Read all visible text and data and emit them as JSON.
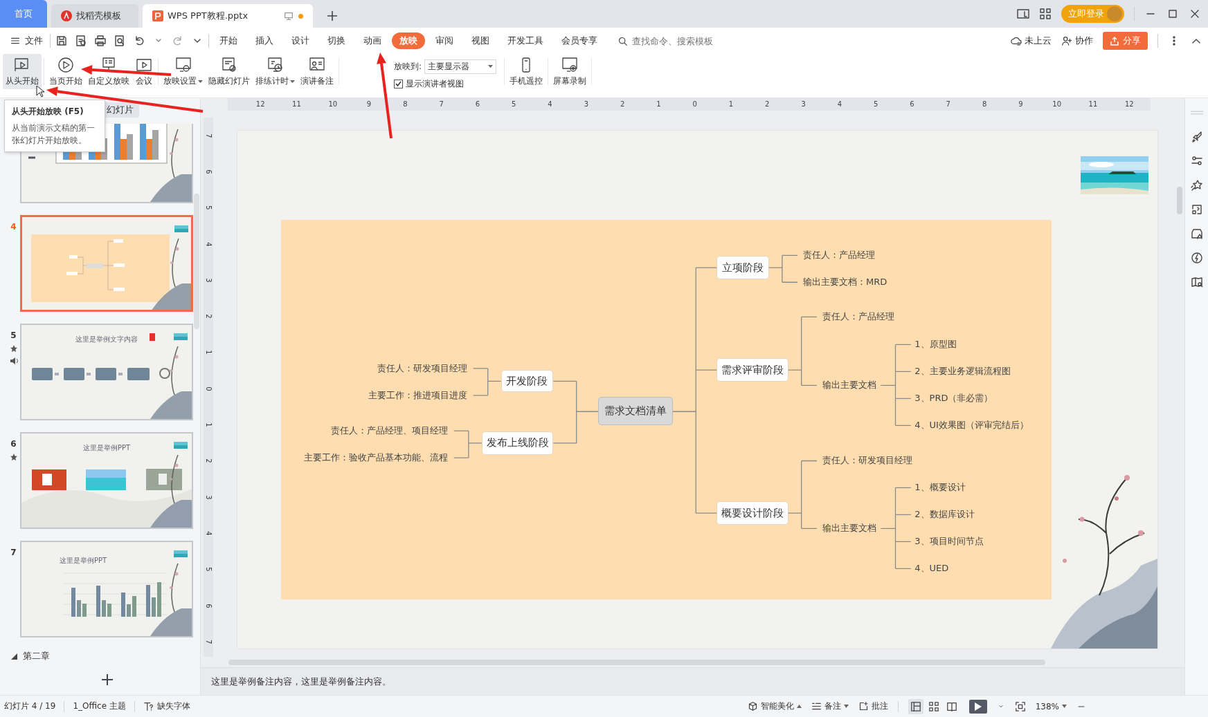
{
  "tabs": [
    {
      "label": "首页",
      "kind": "home",
      "selected": false
    },
    {
      "label": "找稻壳模板",
      "kind": "docer",
      "selected": false
    },
    {
      "label": "WPS PPT教程.pptx",
      "kind": "doc",
      "selected": true,
      "unsaved": true
    }
  ],
  "title_bar": {
    "login_button": "立即登录"
  },
  "menu": {
    "file": "文件",
    "tabs": [
      {
        "label": "开始",
        "selected": false
      },
      {
        "label": "插入",
        "selected": false
      },
      {
        "label": "设计",
        "selected": false
      },
      {
        "label": "切换",
        "selected": false
      },
      {
        "label": "动画",
        "selected": false
      },
      {
        "label": "放映",
        "selected": true
      },
      {
        "label": "审阅",
        "selected": false
      },
      {
        "label": "视图",
        "selected": false
      },
      {
        "label": "开发工具",
        "selected": false
      },
      {
        "label": "会员专享",
        "selected": false
      }
    ],
    "search": {
      "placeholder": "查找命令、搜索模板"
    },
    "cloud": "未上云",
    "collab": "协作",
    "share": "分享"
  },
  "ribbon": {
    "buttons": [
      {
        "label": "从头开始",
        "kind": "from-start",
        "hovered": true,
        "dropdown": false
      },
      {
        "label": "当页开始",
        "kind": "current",
        "hovered": false,
        "dropdown": false
      },
      {
        "label": "自定义放映",
        "kind": "custom",
        "hovered": false,
        "dropdown": false
      },
      {
        "label": "会议",
        "kind": "meeting",
        "hovered": false,
        "dropdown": false
      },
      {
        "label": "放映设置",
        "kind": "settings",
        "hovered": false,
        "dropdown": true
      },
      {
        "label": "隐藏幻灯片",
        "kind": "hide",
        "hovered": false,
        "dropdown": false
      },
      {
        "label": "排练计时",
        "kind": "timing",
        "hovered": false,
        "dropdown": true
      },
      {
        "label": "演讲备注",
        "kind": "notes",
        "hovered": false,
        "dropdown": false
      }
    ],
    "show_to": {
      "label": "放映到:",
      "value": "主要显示器"
    },
    "presenter_view": {
      "label": "显示演讲者视图",
      "checked": true
    },
    "buttons_right": [
      {
        "label": "手机遥控",
        "kind": "phone",
        "hovered": false,
        "dropdown": false
      },
      {
        "label": "屏幕录制",
        "kind": "record",
        "hovered": false,
        "dropdown": false
      }
    ]
  },
  "tooltip": {
    "title": "从头开始放映 (F5)",
    "text": "从当前演示文稿的第一张幻灯片开始放映。"
  },
  "slide_pane": {
    "tab": "幻灯片",
    "slides": [
      {
        "kind": "chart",
        "partial": true,
        "selected": false,
        "animation": false,
        "sound": false
      },
      {
        "number": "4",
        "kind": "mindmap",
        "selected": true,
        "animation": false,
        "sound": false
      },
      {
        "number": "5",
        "kind": "steps",
        "title": "这里是举例文字内容",
        "selected": false,
        "animation": true,
        "sound": true
      },
      {
        "number": "6",
        "kind": "images",
        "title": "这里是举例PPT",
        "selected": false,
        "animation": true,
        "sound": false
      },
      {
        "number": "7",
        "kind": "bars",
        "title": "这里是举例PPT",
        "selected": false,
        "animation": false,
        "sound": false
      }
    ],
    "section": "第二章",
    "section_expanded": true
  },
  "rulers": {
    "horizontal": [
      "12",
      "11",
      "10",
      "9",
      "8",
      "7",
      "6",
      "5",
      "4",
      "3",
      "2",
      "1",
      "0",
      "1",
      "2",
      "3",
      "4",
      "5",
      "6",
      "7",
      "8",
      "9",
      "10",
      "11",
      "12"
    ],
    "vertical": [
      "7",
      "6",
      "5",
      "4",
      "3",
      "2",
      "1",
      "0",
      "1",
      "2",
      "3",
      "4",
      "5",
      "6",
      "7"
    ]
  },
  "slide": {
    "mindmap": {
      "root": "需求文档清单",
      "right": [
        {
          "label": "立项阶段",
          "children": [
            {
              "text": "责任人：产品经理"
            },
            {
              "text": "输出主要文档：MRD"
            }
          ]
        },
        {
          "label": "需求评审阶段",
          "children": [
            {
              "text": "责任人：产品经理"
            },
            {
              "text": "输出主要文档",
              "children": [
                {
                  "text": "1、原型图"
                },
                {
                  "text": "2、主要业务逻辑流程图"
                },
                {
                  "text": "3、PRD（非必需）"
                },
                {
                  "text": "4、UI效果图（评审完结后）"
                }
              ]
            }
          ]
        },
        {
          "label": "概要设计阶段",
          "children": [
            {
              "text": "责任人：研发项目经理"
            },
            {
              "text": "输出主要文档",
              "children": [
                {
                  "text": "1、概要设计"
                },
                {
                  "text": "2、数据库设计"
                },
                {
                  "text": "3、项目时间节点"
                },
                {
                  "text": "4、UED"
                }
              ]
            }
          ]
        }
      ],
      "left": [
        {
          "label": "开发阶段",
          "children": [
            {
              "text": "责任人：研发项目经理"
            },
            {
              "text": "主要工作：推进项目进度"
            }
          ]
        },
        {
          "label": "发布上线阶段",
          "children": [
            {
              "text": "责任人：产品经理、项目经理"
            },
            {
              "text": "主要工作：验收产品基本功能、流程"
            }
          ]
        }
      ]
    }
  },
  "notes": "这里是举例备注内容，这里是举例备注内容。",
  "status_bar": {
    "slide": "幻灯片 4 / 19",
    "theme": "1_Office 主题",
    "fonts": "缺失字体",
    "beautify": "智能美化",
    "notes": "备注",
    "comments": "批注",
    "views": [
      {
        "kind": "normal",
        "selected": true
      },
      {
        "kind": "sorter",
        "selected": false
      },
      {
        "kind": "reading",
        "selected": false
      }
    ],
    "zoom": "138%"
  },
  "annotations": [
    {
      "kind": "arrow",
      "color": "#e8231f"
    },
    {
      "kind": "arrow",
      "color": "#e8231f"
    },
    {
      "kind": "arrow",
      "color": "#e8231f"
    }
  ]
}
